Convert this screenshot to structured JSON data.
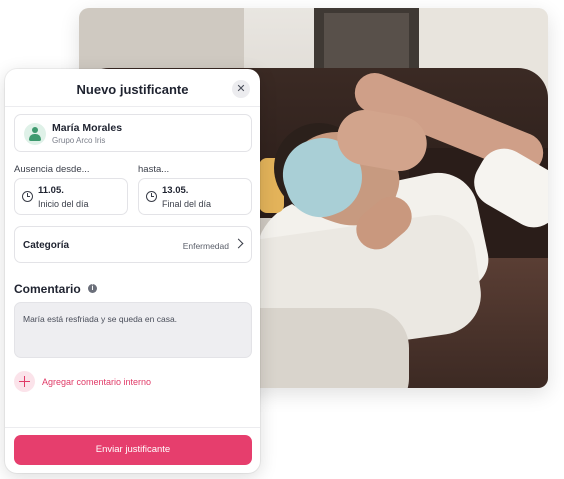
{
  "modal": {
    "title": "Nuevo justificante",
    "close_icon": "close-icon"
  },
  "person": {
    "name": "María Morales",
    "group": "Grupo Arco Iris",
    "avatar_icon": "person-icon"
  },
  "absence": {
    "from_label": "Ausencia desde...",
    "to_label": "hasta...",
    "from": {
      "date": "11.05.",
      "time": "Inicio del día"
    },
    "to": {
      "date": "13.05.",
      "time": "Final del día"
    },
    "icon": "clock-icon"
  },
  "category": {
    "label": "Categoría",
    "value": "Enfermedad"
  },
  "comment": {
    "title": "Comentario",
    "text": "María está resfriada y se queda en casa."
  },
  "internal_comment": {
    "label": "Agregar comentario interno"
  },
  "submit": {
    "label": "Enviar justificante"
  },
  "colors": {
    "accent": "#e63e6d",
    "accent_text": "#e03a67",
    "avatar_bg": "#dff1e8"
  }
}
